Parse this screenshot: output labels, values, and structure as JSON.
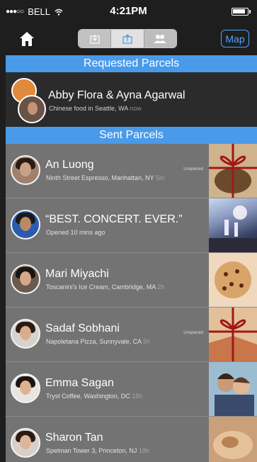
{
  "status": {
    "carrier": "BELL",
    "time": "4:21PM",
    "battery_level": 0.9
  },
  "nav": {
    "map_label": "Map",
    "segments": [
      "download-icon",
      "share-icon",
      "people-icon"
    ]
  },
  "requested": {
    "header": "Requested Parcels",
    "names": "Abby Flora & Ayna Agarwal",
    "place": "Chinese food in Seattle, WA",
    "time": "now"
  },
  "sent": {
    "header": "Sent Parcels",
    "items": [
      {
        "name": "An Luong",
        "place": "Ninth Street Espresso, Manhattan, NY",
        "time": "5m",
        "badge": "Unopened"
      },
      {
        "name": "“BEST. CONCERT. EVER.”",
        "place": "Opened 10 mins ago",
        "time": "",
        "badge": ""
      },
      {
        "name": "Mari Miyachi",
        "place": "Toscanini's Ice Cream, Cambridge, MA",
        "time": "2h",
        "badge": ""
      },
      {
        "name": "Sadaf Sobhani",
        "place": "Napoletana Pizza, Sunnyvale, CA",
        "time": "5h",
        "badge": "Unopened"
      },
      {
        "name": "Emma Sagan",
        "place": "Tryst Coffee, Washington, DC",
        "time": "18h",
        "badge": ""
      },
      {
        "name": "Sharon Tan",
        "place": "Spelman Tower 3, Princeton, NJ",
        "time": "18h",
        "badge": ""
      }
    ]
  },
  "colors": {
    "accent": "#4a9aea",
    "map": "#4fa3ff",
    "row": "#737373",
    "header": "#1e1e1e"
  }
}
